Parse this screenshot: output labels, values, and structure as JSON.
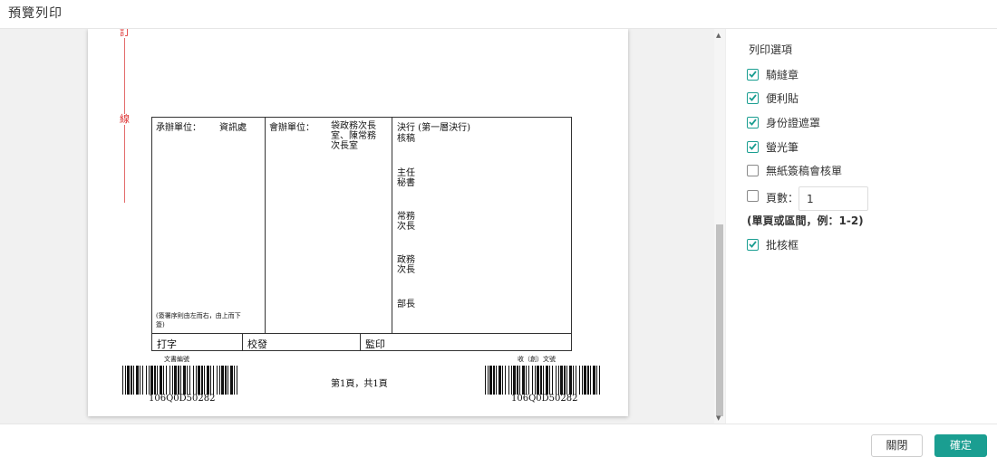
{
  "window": {
    "title": "預覽列印"
  },
  "document": {
    "margin_mark_top": "訂",
    "margin_mark_mid": "線",
    "undertaking_label": "承辦單位：",
    "undertaking_value": "資訊處",
    "cosign_label": "會辦單位：",
    "cosign_value_1": "袋政務次長",
    "cosign_value_2": "室、陳常務",
    "cosign_value_3": "次長室",
    "decision_label": "決行 (第一層決行)",
    "approvals": [
      "核稿",
      "主任",
      "秘書",
      "常務",
      "次長",
      "政務",
      "次長",
      "部長"
    ],
    "sign_order_note_1": "(簽署序則由左而右，由上而下",
    "sign_order_note_2": "簽)",
    "sign_row": {
      "typing": "打字",
      "proofread": "校發",
      "supervise": "監印"
    },
    "barcode_left_caption": "文書編號",
    "barcode_right_caption": "收（創）文號",
    "barcode_left_number": "106Q0D50282",
    "barcode_right_number": "106Q0D50282",
    "page_info": "第1頁，共1頁"
  },
  "options": {
    "title": "列印選項",
    "items": [
      {
        "label": "騎縫章",
        "checked": true
      },
      {
        "label": "便利貼",
        "checked": true
      },
      {
        "label": "身份證遮罩",
        "checked": true
      },
      {
        "label": "螢光筆",
        "checked": true
      },
      {
        "label": "無紙簽稿會核單",
        "checked": false
      },
      {
        "label": "頁數：",
        "checked": false
      },
      {
        "label": "批核框",
        "checked": true
      }
    ],
    "page_value": "1",
    "hint": "(單頁或區間，例：1-2)"
  },
  "footer": {
    "close_label": "關閉",
    "ok_label": "確定"
  },
  "colors": {
    "accent": "#1a9e91",
    "margin_red": "#e36a6a"
  }
}
